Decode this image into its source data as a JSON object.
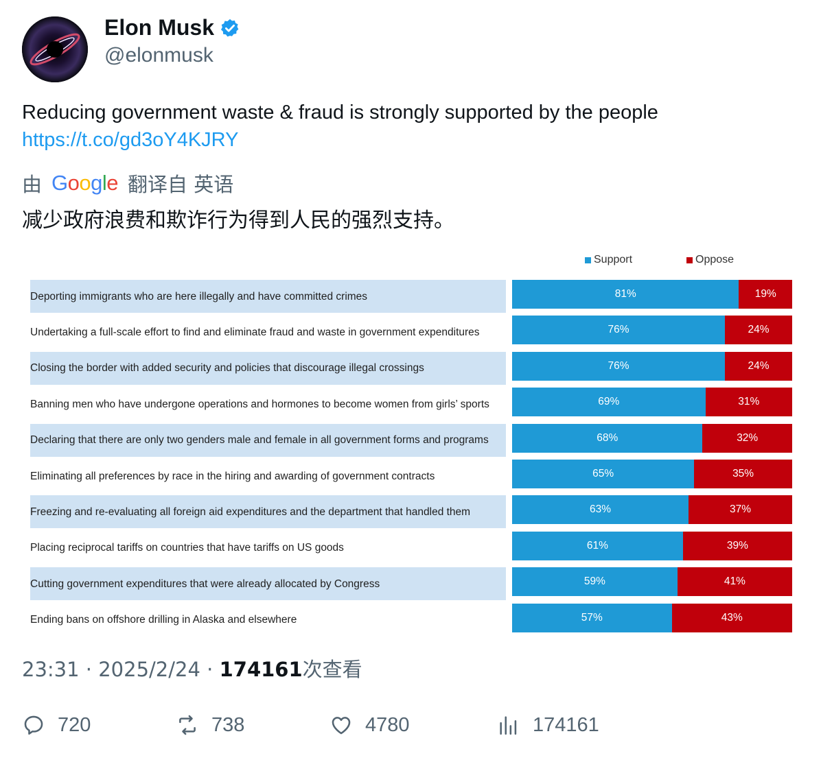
{
  "user": {
    "display_name": "Elon Musk",
    "handle": "@elonmusk"
  },
  "tweet": {
    "text": "Reducing government waste & fraud is strongly supported by the people",
    "link": "https://t.co/gd3oY4KJRY"
  },
  "translation": {
    "prefix": "由",
    "provider": "Google",
    "suffix": "翻译自 英语",
    "text": "减少政府浪费和欺诈行为得到人民的强烈支持。"
  },
  "meta": {
    "time": "23:31",
    "date": "2025/2/24",
    "views": "174161",
    "views_suffix": "次查看"
  },
  "actions": {
    "replies": "720",
    "retweets": "738",
    "likes": "4780",
    "views": "174161"
  },
  "colors": {
    "support": "#1f9ad6",
    "oppose": "#c0000b",
    "label_bg": "#cfe2f3",
    "link": "#1d9bf0",
    "verified": "#1d9bf0"
  },
  "chart_data": {
    "type": "bar",
    "stacked": true,
    "orientation": "horizontal",
    "legend": "top-right",
    "categories": [
      "Deporting immigrants who are here illegally and have committed crimes",
      "Undertaking a full-scale effort to find and eliminate fraud and waste in government expenditures",
      "Closing the border with added security and policies that discourage illegal crossings",
      "Banning men who have undergone operations and hormones to become women from girls’ sports",
      "Declaring that there are only two genders male and female in all government forms and programs",
      "Eliminating all preferences by race in the hiring and awarding of government contracts",
      "Freezing and re-evaluating all foreign aid expenditures and the department that handled them",
      "Placing reciprocal tariffs on countries that have tariffs on US goods",
      "Cutting government expenditures that were already allocated by Congress",
      "Ending bans on offshore drilling in Alaska and elsewhere"
    ],
    "series": [
      {
        "name": "Support",
        "values": [
          81,
          76,
          76,
          69,
          68,
          65,
          63,
          61,
          59,
          57
        ],
        "labels": [
          "81%",
          "76%",
          "76%",
          "69%",
          "68%",
          "65%",
          "63%",
          "61%",
          "59%",
          "57%"
        ]
      },
      {
        "name": "Oppose",
        "values": [
          19,
          24,
          24,
          31,
          32,
          35,
          37,
          39,
          41,
          43
        ],
        "labels": [
          "19%",
          "24%",
          "24%",
          "31%",
          "32%",
          "35%",
          "37%",
          "39%",
          "41%",
          "43%"
        ]
      }
    ],
    "xlim": [
      0,
      100
    ]
  }
}
